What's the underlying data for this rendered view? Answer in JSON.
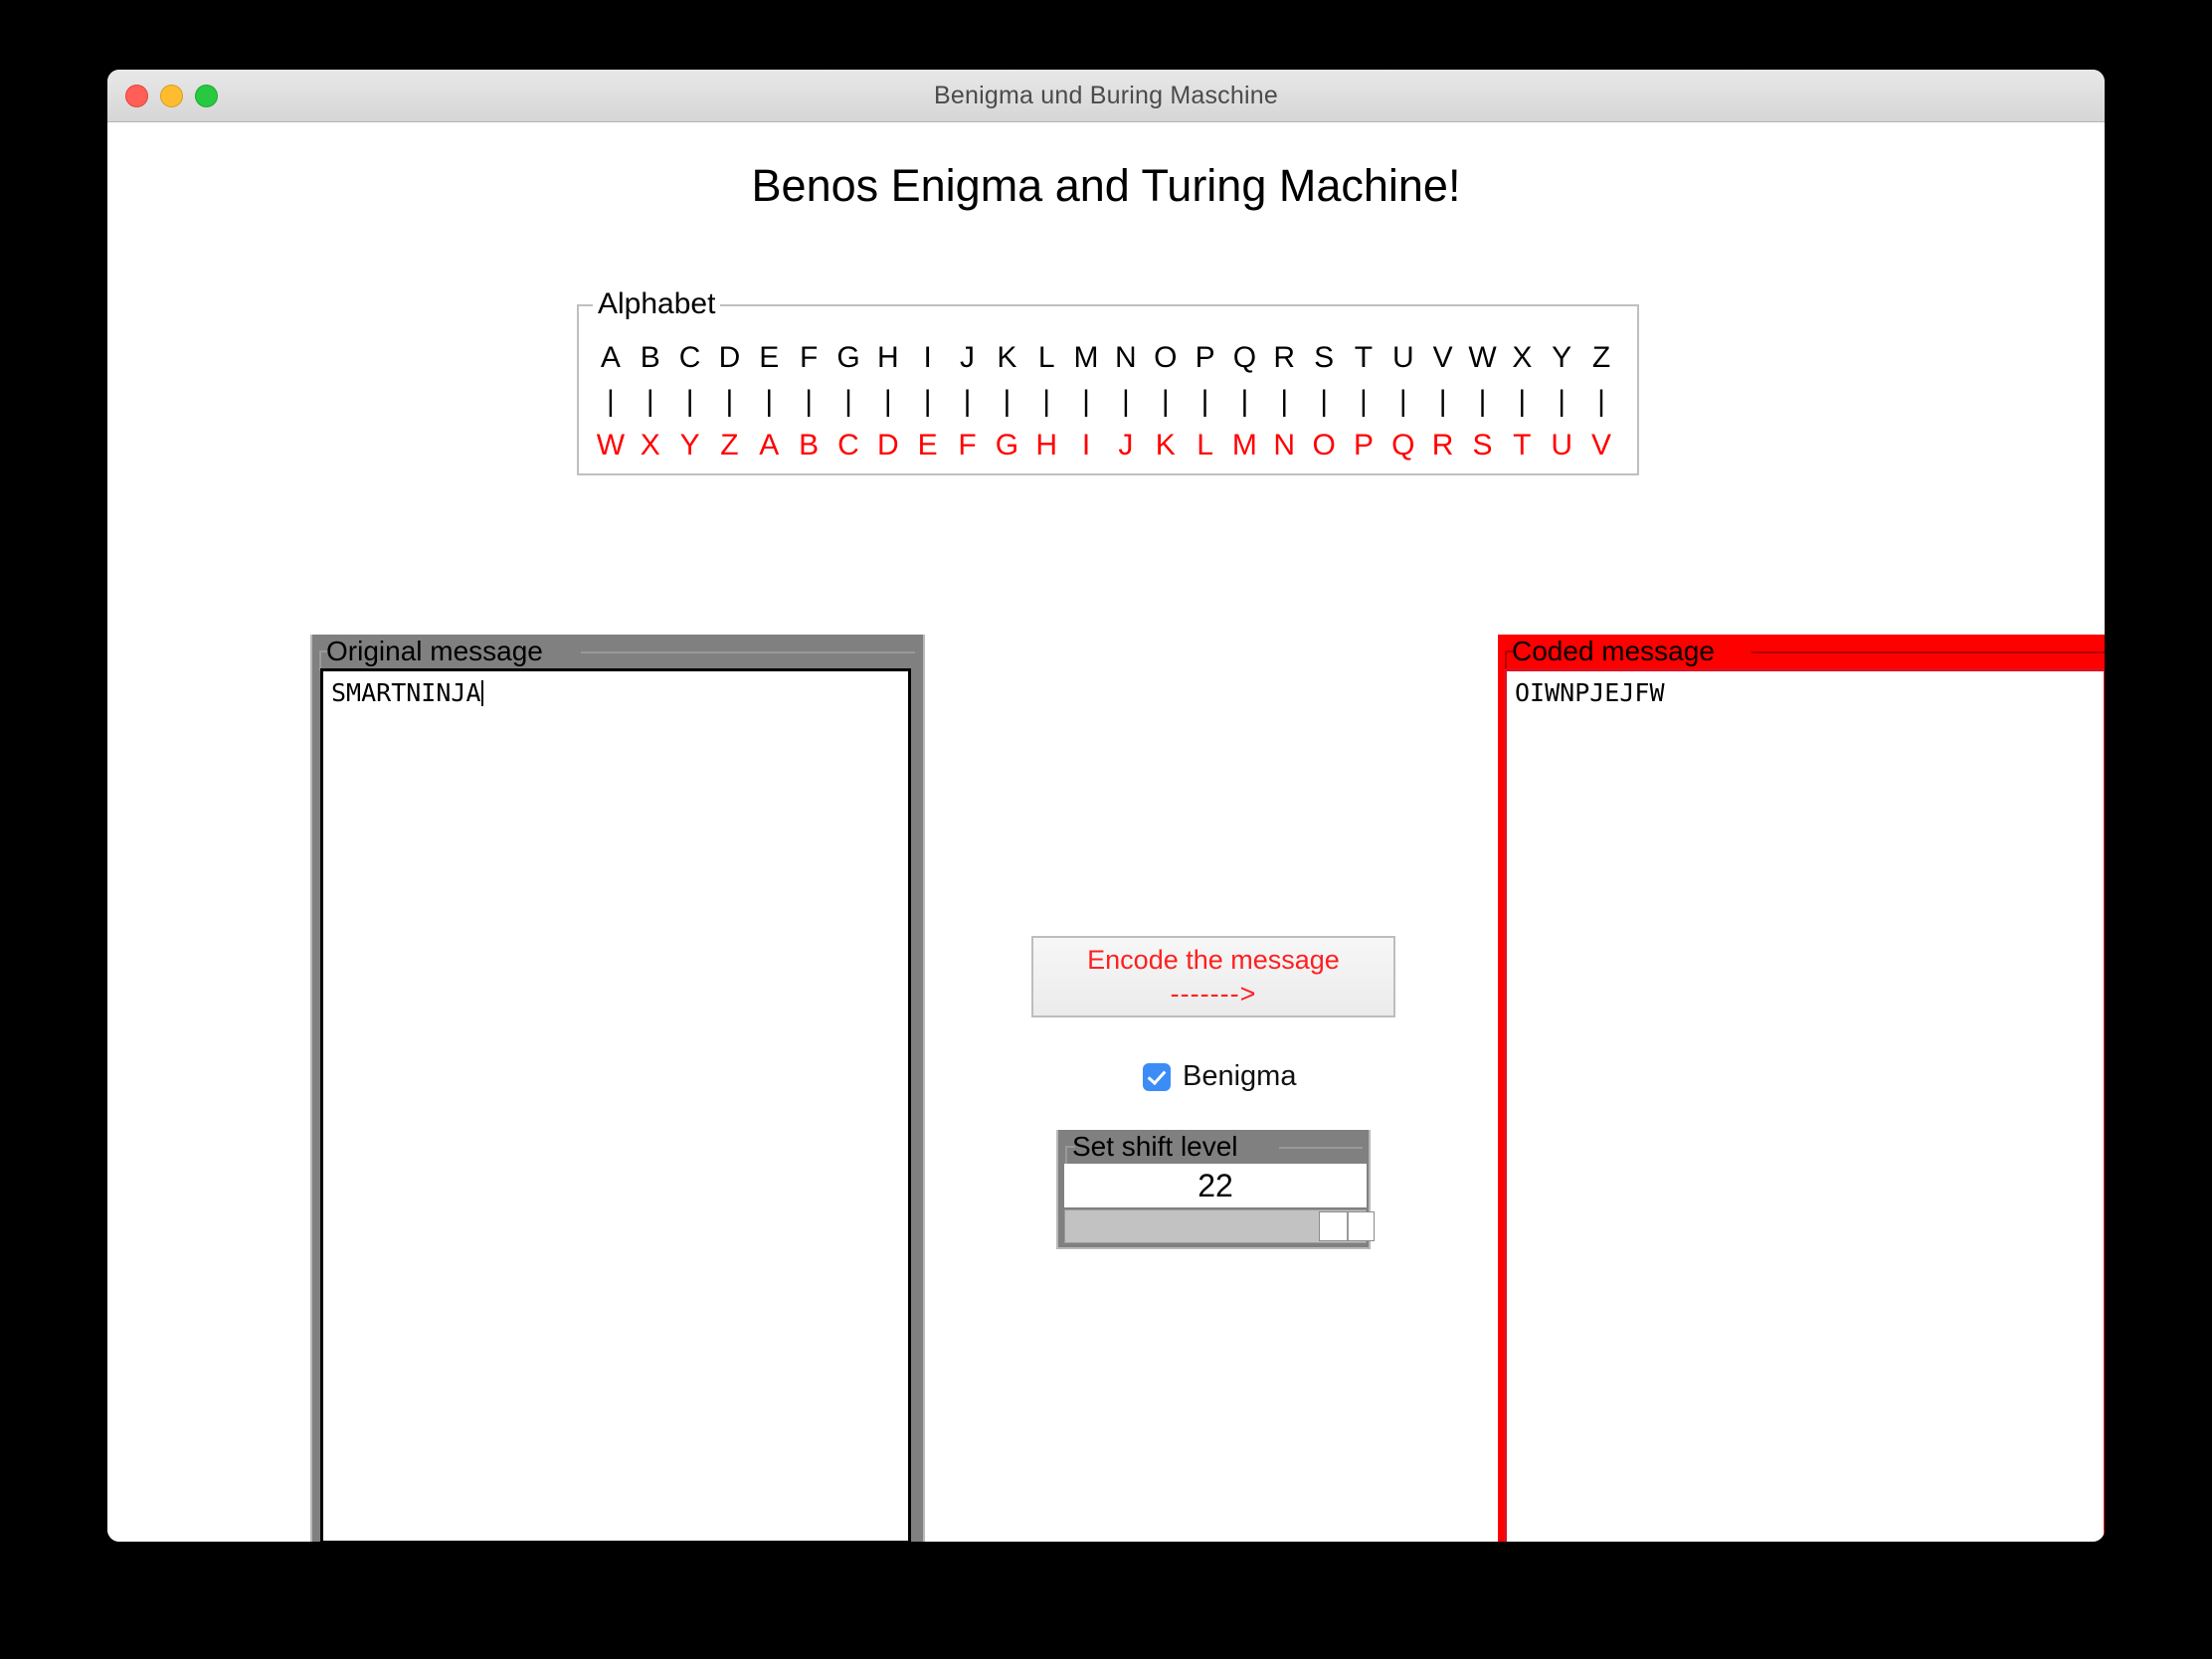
{
  "window": {
    "title": "Benigma und Buring Maschine",
    "traffic_lights": [
      "close",
      "minimize",
      "maximize"
    ]
  },
  "heading": "Benos Enigma and Turing Machine!",
  "alphabet": {
    "legend": "Alphabet",
    "separator": "|",
    "plain": [
      "A",
      "B",
      "C",
      "D",
      "E",
      "F",
      "G",
      "H",
      "I",
      "J",
      "K",
      "L",
      "M",
      "N",
      "O",
      "P",
      "Q",
      "R",
      "S",
      "T",
      "U",
      "V",
      "W",
      "X",
      "Y",
      "Z"
    ],
    "cipher": [
      "W",
      "X",
      "Y",
      "Z",
      "A",
      "B",
      "C",
      "D",
      "E",
      "F",
      "G",
      "H",
      "I",
      "J",
      "K",
      "L",
      "M",
      "N",
      "O",
      "P",
      "Q",
      "R",
      "S",
      "T",
      "U",
      "V"
    ],
    "cipher_color": "#ff0000"
  },
  "original_panel": {
    "legend": "Original message",
    "text": "SMARTNINJA"
  },
  "coded_panel": {
    "legend": "Coded message",
    "text": "OIWNPJEJFW",
    "accent_color": "#ff0000"
  },
  "encode_button": {
    "line1": "Encode the message",
    "line2": "------->",
    "color": "#ff2020"
  },
  "benigma": {
    "label": "Benigma",
    "checked": true,
    "checkbox_color": "#3b8cf7"
  },
  "shift": {
    "legend": "Set shift level",
    "value": "22"
  }
}
